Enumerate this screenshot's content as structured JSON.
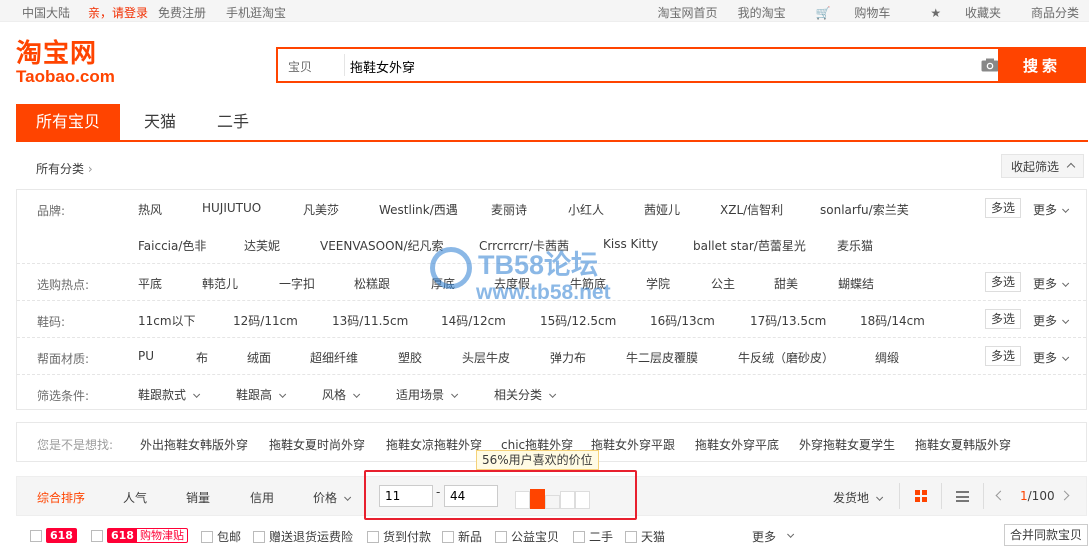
{
  "topbar": {
    "region": "中国大陆",
    "login": "亲，请登录",
    "register": "免费注册",
    "mobile": "手机逛淘宝",
    "home": "淘宝网首页",
    "my": "我的淘宝",
    "cart": "购物车",
    "fav": "收藏夹",
    "category": "商品分类"
  },
  "logo": {
    "cn": "淘宝网",
    "en": "Taobao.com"
  },
  "search": {
    "type": "宝贝",
    "value": "拖鞋女外穿",
    "button": "搜索"
  },
  "tabs": [
    "所有宝贝",
    "天猫",
    "二手"
  ],
  "catbar": {
    "all": "所有分类",
    "fold": "收起筛选"
  },
  "filters": {
    "brand": {
      "label": "品牌:",
      "items": [
        "热风",
        "HUJIUTUO",
        "凡美莎",
        "Westlink/西遇",
        "麦丽诗",
        "小红人",
        "茜娅儿",
        "XZL/信智利",
        "sonlarfu/索兰芙",
        "Faiccia/色非",
        "达芙妮",
        "VEENVASOON/纪凡索",
        "Crrcrrcrr/卡茜茜",
        "Kiss Kitty",
        "ballet star/芭蕾星光",
        "麦乐猫"
      ]
    },
    "hot": {
      "label": "选购热点:",
      "items": [
        "平底",
        "韩范儿",
        "一字扣",
        "松糕跟",
        "厚底",
        "去度假",
        "牛筋底",
        "学院",
        "公主",
        "甜美",
        "蝴蝶结"
      ]
    },
    "size": {
      "label": "鞋码:",
      "items": [
        "11cm以下",
        "12码/11cm",
        "13码/11.5cm",
        "14码/12cm",
        "15码/12.5cm",
        "16码/13cm",
        "17码/13.5cm",
        "18码/14cm"
      ]
    },
    "material": {
      "label": "帮面材质:",
      "items": [
        "PU",
        "布",
        "绒面",
        "超细纤维",
        "塑胶",
        "头层牛皮",
        "弹力布",
        "牛二层皮覆膜",
        "牛反绒（磨砂皮）",
        "绸缎"
      ]
    },
    "cond": {
      "label": "筛选条件:",
      "items": [
        "鞋跟款式",
        "鞋跟高",
        "风格",
        "适用场景",
        "相关分类"
      ]
    },
    "multi": "多选",
    "more": "更多"
  },
  "suggest": {
    "label": "您是不是想找:",
    "items": [
      "外出拖鞋女韩版外穿",
      "拖鞋女夏时尚外穿",
      "拖鞋女凉拖鞋外穿",
      "chic拖鞋外穿",
      "拖鞋女外穿平跟",
      "拖鞋女外穿平底",
      "外穿拖鞋女夏学生",
      "拖鞋女夏韩版外穿"
    ]
  },
  "sort": {
    "items": [
      "综合排序",
      "人气",
      "销量",
      "信用",
      "价格"
    ],
    "price_min": "11",
    "price_max": "44",
    "tooltip": "56%用户喜欢的价位",
    "ship": "发货地",
    "page_current": "1",
    "page_total": "/100"
  },
  "options": {
    "b618": "618",
    "b618_a": "618",
    "b618_c": "购物津贴",
    "items": [
      "包邮",
      "赠送退货运费险",
      "货到付款",
      "新品",
      "公益宝贝",
      "二手",
      "天猫"
    ],
    "more": "更多",
    "merge": "合并同款宝贝"
  },
  "watermark": {
    "t1": "TB58论坛",
    "t2": "www.tb58.net"
  },
  "colors": {
    "accent": "#ff4400",
    "red618": "#ff0036",
    "highlight": "#e8202e"
  }
}
